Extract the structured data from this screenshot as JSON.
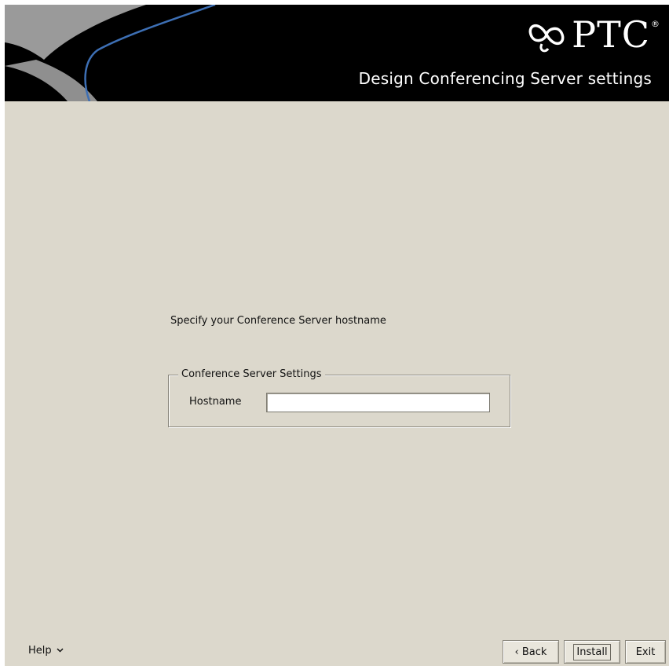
{
  "window": {
    "brand": "PTC",
    "brand_mark": "®",
    "title": "Design Conferencing Server settings"
  },
  "content": {
    "prompt": "Specify your Conference Server hostname",
    "group_legend": "Conference Server Settings",
    "hostname_label": "Hostname",
    "hostname_value": "",
    "hostname_placeholder": ""
  },
  "footer": {
    "help_label": "Help",
    "help_icon": "chevron-down-icon",
    "back_label": "‹ Back",
    "install_label": "Install",
    "exit_label": "Exit"
  },
  "colors": {
    "banner": "#000000",
    "swoosh_gray": "#9a9a9a",
    "swoosh_blue": "#3d6fb4",
    "panel": "#dcd8cc"
  }
}
